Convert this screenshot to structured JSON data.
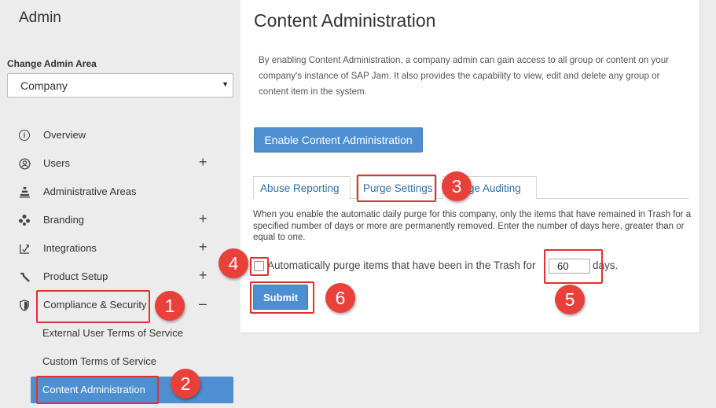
{
  "sidebar": {
    "title": "Admin",
    "area_label": "Change Admin Area",
    "area_select": {
      "value": "Company"
    },
    "items": [
      {
        "label": "Overview",
        "icon": "info-icon",
        "expandable": false
      },
      {
        "label": "Users",
        "icon": "user-icon",
        "expandable": true,
        "toggle": "+"
      },
      {
        "label": "Administrative Areas",
        "icon": "hierarchy-icon",
        "expandable": false
      },
      {
        "label": "Branding",
        "icon": "palette-icon",
        "expandable": true,
        "toggle": "+"
      },
      {
        "label": "Integrations",
        "icon": "integration-icon",
        "expandable": true,
        "toggle": "+"
      },
      {
        "label": "Product Setup",
        "icon": "wrench-icon",
        "expandable": true,
        "toggle": "+"
      },
      {
        "label": "Compliance & Security",
        "icon": "shield-icon",
        "expandable": true,
        "toggle": "–"
      }
    ],
    "sub_items": [
      {
        "label": "External User Terms of Service"
      },
      {
        "label": "Custom Terms of Service"
      },
      {
        "label": "Content Administration",
        "active": true
      }
    ]
  },
  "main": {
    "title": "Content Administration",
    "description": "By enabling Content Administration, a company admin can gain access to all group or content on your company's instance of SAP Jam. It also provides the capability to view, edit and delete any group or content item in the system.",
    "enable_button": "Enable Content Administration",
    "tabs": [
      {
        "label": "Abuse Reporting"
      },
      {
        "label": "Purge Settings",
        "active": true
      },
      {
        "label": "Usage Auditing"
      }
    ],
    "purge_description": "When you enable the automatic daily purge for this company, only the items that have remained in Trash for a specified number of days or more are permanently removed. Enter the number of days here, greater than or equal to one.",
    "auto_purge_label": "Automatically purge items that have been in the Trash for",
    "auto_purge_checked": false,
    "days_value": "60",
    "days_suffix": "days.",
    "submit_button": "Submit"
  },
  "annotations": {
    "color": "#e8413a",
    "badges": [
      "1",
      "2",
      "3",
      "4",
      "5",
      "6"
    ]
  }
}
